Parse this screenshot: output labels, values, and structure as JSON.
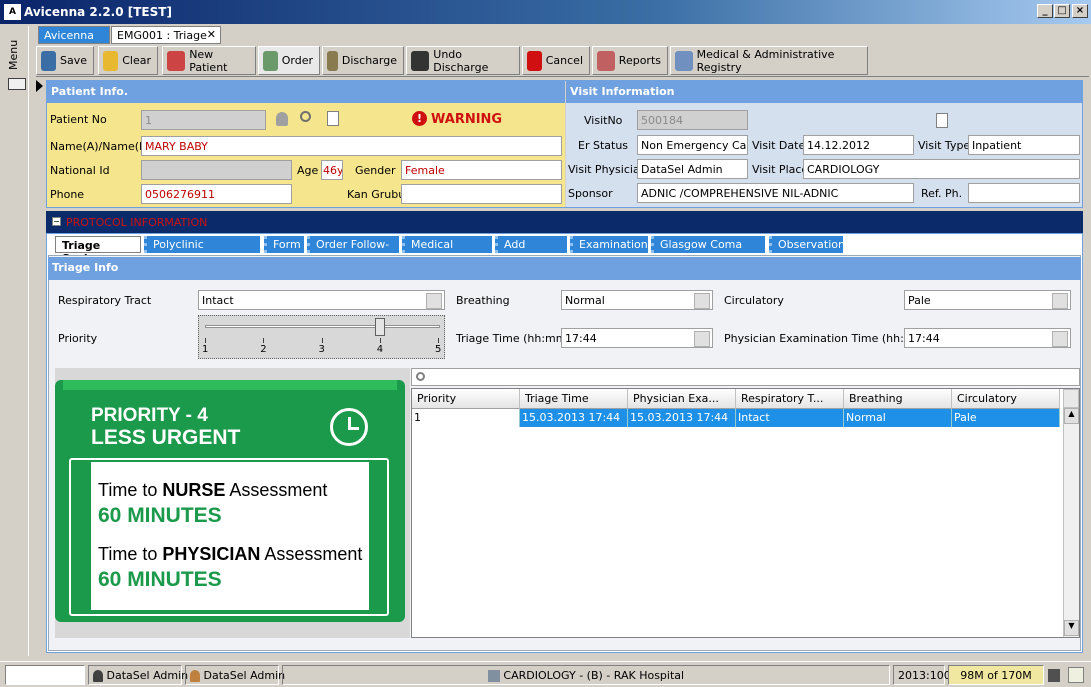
{
  "window": {
    "title": "Avicenna 2.2.0 [TEST]",
    "logo": "A"
  },
  "left": {
    "menu_label": "Menu"
  },
  "tabs": [
    {
      "label": "Avicenna 2.0"
    },
    {
      "label": "EMG001 : Triage"
    }
  ],
  "toolbar": [
    {
      "label": "Save",
      "icon": "save-icon"
    },
    {
      "label": "Clear",
      "icon": "broom-icon"
    },
    {
      "label": "New Patient",
      "icon": "new-patient-icon"
    },
    {
      "label": "Order",
      "icon": "order-icon"
    },
    {
      "label": "Discharge",
      "icon": "discharge-icon"
    },
    {
      "label": "Undo Discharge",
      "icon": "undo-discharge-icon"
    },
    {
      "label": "Cancel",
      "icon": "cancel-icon"
    },
    {
      "label": "Reports",
      "icon": "reports-icon"
    },
    {
      "label": "Medical & Administrative Registry",
      "icon": "registry-icon"
    }
  ],
  "patient": {
    "header": "Patient Info.",
    "patient_no_label": "Patient No",
    "patient_no": "1",
    "warning": "WARNING",
    "name_label": "Name(A)/Name(E)",
    "name": "MARY  BABY",
    "national_id_label": "National Id",
    "national_id": "",
    "age_label": "Age",
    "age": "46y",
    "gender_label": "Gender",
    "gender": "Female",
    "phone_label": "Phone",
    "phone": "0506276911",
    "kan_grubu_label": "Kan Grubu",
    "kan_grubu": ""
  },
  "visit": {
    "header": "Visit Information",
    "visit_no_label": "VisitNo",
    "visit_no": "500184",
    "er_status_label": "Er Status",
    "er_status": "Non Emergency Case",
    "visit_date_label": "Visit Date",
    "visit_date": "14.12.2012",
    "visit_type_label": "Visit Type",
    "visit_type": "Inpatient",
    "visit_physician_label": "Visit Physician",
    "visit_physician": "DataSel  Admin",
    "visit_place_label": "Visit Place",
    "visit_place": "CARDIOLOGY",
    "sponsor_label": "Sponsor",
    "sponsor": "ADNIC /COMPREHENSIVE NIL-ADNIC",
    "ref_ph_label": "Ref. Ph.",
    "ref_ph": ""
  },
  "protocol": {
    "header": "PROTOCOL INFORMATION"
  },
  "protocol_tabs": [
    "Triage Scale",
    "Polyclinic Information",
    "Form",
    "Order Follow-up",
    "Medical Record",
    "Add Service",
    "Examinations",
    "Glasgow Coma Scale",
    "Observation"
  ],
  "triage": {
    "header": "Triage Info",
    "resp_label": "Respiratory Tract",
    "resp": "Intact",
    "breathing_label": "Breathing",
    "breathing": "Normal",
    "circ_label": "Circulatory",
    "circ": "Pale",
    "priority_label": "Priority",
    "priority_value": 4,
    "slider_ticks": [
      "1",
      "2",
      "3",
      "4",
      "5"
    ],
    "triage_time_label": "Triage Time (hh:mm)",
    "triage_time": "17:44",
    "phys_time_label": "Physician Examination Time (hh:mm)",
    "phys_time": "17:44"
  },
  "card": {
    "title1": "PRIORITY - 4",
    "title2": "LESS URGENT",
    "nurse_pre": "Time to ",
    "nurse_bold": "NURSE",
    "nurse_post": " Assessment",
    "nurse_time": "60 MINUTES",
    "phys_pre": "Time to ",
    "phys_bold": "PHYSICIAN",
    "phys_post": " Assessment",
    "phys_time": "60 MINUTES",
    "color": "#1a9a4a"
  },
  "grid": {
    "columns": [
      "Priority",
      "Triage Time",
      "Physician Exa...",
      "Respiratory T...",
      "Breathing",
      "Circulatory"
    ],
    "rows": [
      [
        "1",
        "15.03.2013 17:44",
        "15.03.2013 17:44",
        "Intact",
        "Normal",
        "Pale"
      ]
    ]
  },
  "status": {
    "user1": "DataSel Admin",
    "user2": "DataSel Admin",
    "location": "CARDIOLOGY - (B) - RAK Hospital",
    "code": "2013:100",
    "memory": "98M of 170M"
  }
}
